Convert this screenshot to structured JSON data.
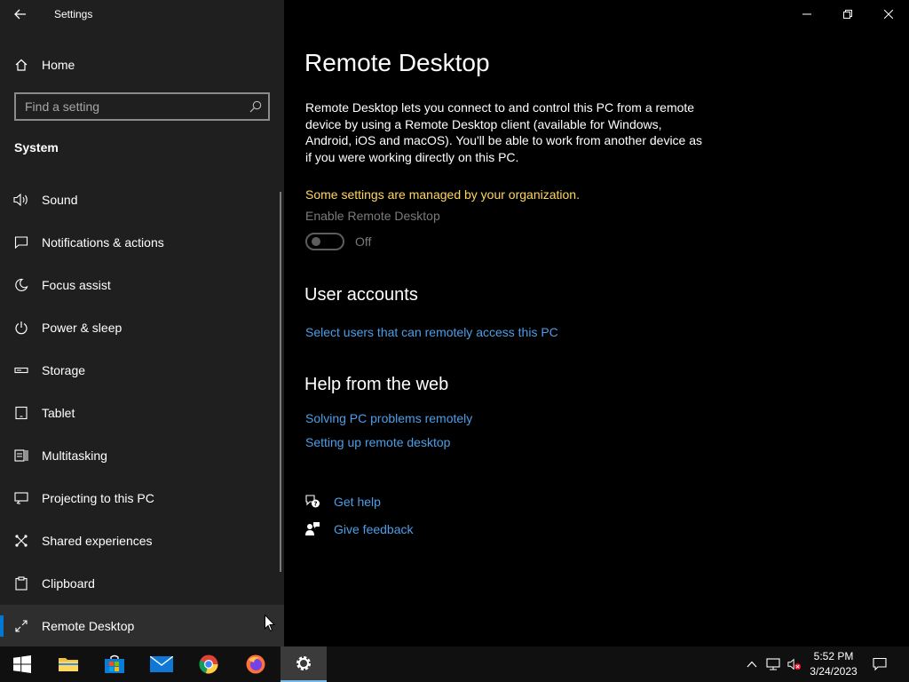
{
  "window": {
    "title": "Settings"
  },
  "sidebar": {
    "home_label": "Home",
    "search_placeholder": "Find a setting",
    "section_label": "System",
    "items": [
      {
        "label": "Sound",
        "icon": "speaker-icon"
      },
      {
        "label": "Notifications & actions",
        "icon": "message-icon"
      },
      {
        "label": "Focus assist",
        "icon": "moon-icon"
      },
      {
        "label": "Power & sleep",
        "icon": "power-icon"
      },
      {
        "label": "Storage",
        "icon": "storage-icon"
      },
      {
        "label": "Tablet",
        "icon": "tablet-icon"
      },
      {
        "label": "Multitasking",
        "icon": "multitasking-icon"
      },
      {
        "label": "Projecting to this PC",
        "icon": "projecting-icon"
      },
      {
        "label": "Shared experiences",
        "icon": "shared-icon"
      },
      {
        "label": "Clipboard",
        "icon": "clipboard-icon"
      },
      {
        "label": "Remote Desktop",
        "icon": "remote-desktop-icon",
        "selected": true
      }
    ]
  },
  "main": {
    "title": "Remote Desktop",
    "description": "Remote Desktop lets you connect to and control this PC from a remote device by using a Remote Desktop client (available for Windows, Android, iOS and macOS). You'll be able to work from another device as if you were working directly on this PC.",
    "managed_notice": "Some settings are managed by your organization.",
    "toggle": {
      "label": "Enable Remote Desktop",
      "state": "Off"
    },
    "user_accounts": {
      "heading": "User accounts",
      "link": "Select users that can remotely access this PC"
    },
    "help_web": {
      "heading": "Help from the web",
      "links": [
        "Solving PC problems remotely",
        "Setting up remote desktop"
      ]
    },
    "get_help": "Get help",
    "give_feedback": "Give feedback"
  },
  "taskbar": {
    "time": "5:52 PM",
    "date": "3/24/2023",
    "colors": {
      "accent": "#0078d4",
      "link": "#4c9ee8",
      "warning": "#ffd75e"
    }
  }
}
